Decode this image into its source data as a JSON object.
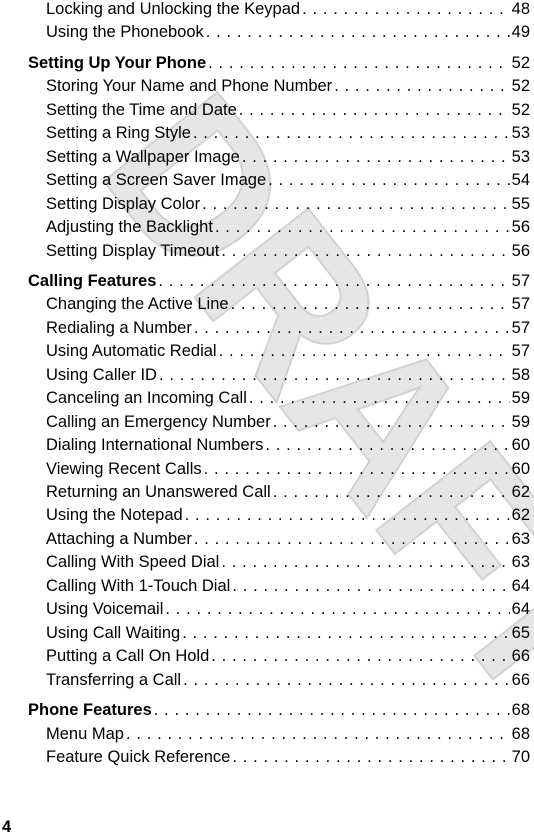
{
  "watermark": "DRAFT",
  "page_number": "4",
  "toc": [
    {
      "level": "sub",
      "title": "Locking and Unlocking the Keypad",
      "page": "48"
    },
    {
      "level": "sub",
      "title": "Using the Phonebook",
      "page": "49"
    },
    {
      "level": "section",
      "title": "Setting Up Your Phone",
      "page": "52"
    },
    {
      "level": "sub",
      "title": "Storing Your Name and Phone Number",
      "page": "52"
    },
    {
      "level": "sub",
      "title": "Setting the Time and Date",
      "page": "52"
    },
    {
      "level": "sub",
      "title": "Setting a Ring Style",
      "page": "53"
    },
    {
      "level": "sub",
      "title": "Setting a Wallpaper Image",
      "page": "53"
    },
    {
      "level": "sub",
      "title": "Setting a Screen Saver Image",
      "page": "54"
    },
    {
      "level": "sub",
      "title": "Setting Display Color",
      "page": "55"
    },
    {
      "level": "sub",
      "title": "Adjusting the Backlight",
      "page": "56"
    },
    {
      "level": "sub",
      "title": "Setting Display Timeout",
      "page": "56"
    },
    {
      "level": "section",
      "title": "Calling Features",
      "page": "57"
    },
    {
      "level": "sub",
      "title": "Changing the Active Line",
      "page": "57"
    },
    {
      "level": "sub",
      "title": "Redialing a Number",
      "page": "57"
    },
    {
      "level": "sub",
      "title": "Using Automatic Redial",
      "page": "57"
    },
    {
      "level": "sub",
      "title": "Using Caller ID",
      "page": "58"
    },
    {
      "level": "sub",
      "title": "Canceling an Incoming Call",
      "page": "59"
    },
    {
      "level": "sub",
      "title": "Calling an Emergency Number",
      "page": "59"
    },
    {
      "level": "sub",
      "title": "Dialing International Numbers",
      "page": "60"
    },
    {
      "level": "sub",
      "title": "Viewing Recent Calls",
      "page": "60"
    },
    {
      "level": "sub",
      "title": "Returning an Unanswered Call",
      "page": "62"
    },
    {
      "level": "sub",
      "title": "Using the Notepad",
      "page": "62"
    },
    {
      "level": "sub",
      "title": "Attaching a Number",
      "page": "63"
    },
    {
      "level": "sub",
      "title": "Calling With Speed Dial",
      "page": "63"
    },
    {
      "level": "sub",
      "title": "Calling With 1-Touch Dial",
      "page": "64"
    },
    {
      "level": "sub",
      "title": "Using Voicemail",
      "page": "64"
    },
    {
      "level": "sub",
      "title": "Using Call Waiting",
      "page": "65"
    },
    {
      "level": "sub",
      "title": "Putting a Call On Hold",
      "page": "66"
    },
    {
      "level": "sub",
      "title": "Transferring a Call",
      "page": "66"
    },
    {
      "level": "section",
      "title": "Phone Features",
      "page": "68"
    },
    {
      "level": "sub",
      "title": "Menu Map",
      "page": "68"
    },
    {
      "level": "sub",
      "title": "Feature Quick Reference",
      "page": "70"
    }
  ]
}
